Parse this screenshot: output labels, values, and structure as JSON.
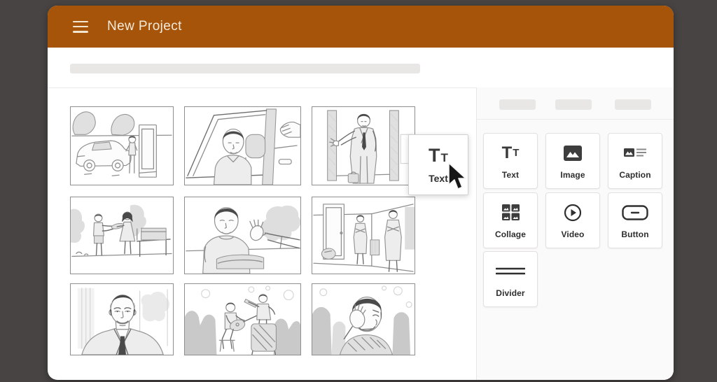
{
  "colors": {
    "background": "#474443",
    "header": "#A65409",
    "header_text": "#F5EADA",
    "placeholder": "#E9E7E6",
    "panel_background": "#FBFAFA"
  },
  "header": {
    "title": "New Project",
    "menu_icon": "hamburger-icon"
  },
  "panel": {
    "items": [
      {
        "label": "Text",
        "icon": "text-icon"
      },
      {
        "label": "Image",
        "icon": "image-icon"
      },
      {
        "label": "Caption",
        "icon": "caption-icon"
      },
      {
        "label": "Collage",
        "icon": "collage-icon"
      },
      {
        "label": "Video",
        "icon": "video-icon"
      },
      {
        "label": "Button",
        "icon": "button-icon"
      },
      {
        "label": "Divider",
        "icon": "divider-icon"
      }
    ]
  },
  "drag_item": {
    "label": "Text",
    "icon": "text-icon"
  },
  "storyboard": {
    "frames": [
      {
        "description": "Man standing beside a car next to a phone booth among trees"
      },
      {
        "description": "Man sitting in a car while a hand reaches toward the door"
      },
      {
        "description": "Man in a suit gesturing with an open hand in a doorway"
      },
      {
        "description": "Two people exchanging an item outdoors near a table with a box"
      },
      {
        "description": "Man in a t-shirt handing over a folded blanket to an open hand"
      },
      {
        "description": "Two men in suits with crossed arms standing in a room by a door"
      },
      {
        "description": "Portrait of a smiling man in a suit"
      },
      {
        "description": "Two musicians playing instruments in front of an audience"
      },
      {
        "description": "Distressed man covering his face with his hand"
      }
    ]
  }
}
